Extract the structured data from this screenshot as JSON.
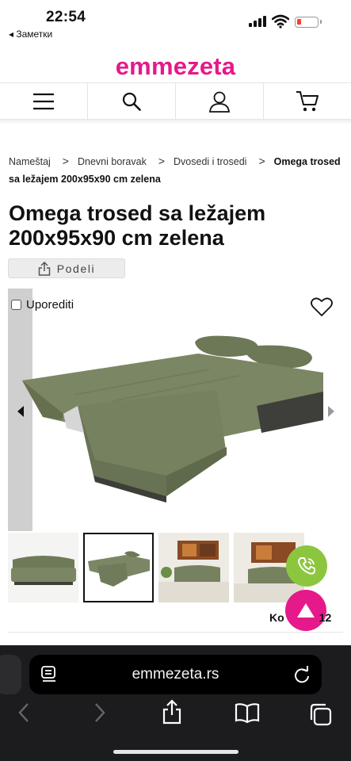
{
  "status_bar": {
    "time": "22:54",
    "back_label": "◂ Заметки"
  },
  "site": {
    "logo": "emmezeta",
    "brand_color": "#e5198a"
  },
  "header_icons": [
    "menu-icon",
    "search-icon",
    "user-icon",
    "cart-icon"
  ],
  "breadcrumb": {
    "items": [
      "Nameštaj",
      "Dnevni boravak",
      "Dvosedi i trosedi"
    ],
    "current": "Omega trosed sa ležajem 200x95x90 cm zelena",
    "separator": ">"
  },
  "product": {
    "title": "Omega trosed sa ležajem 200x95x90 cm zelena",
    "share_label": "Podeli",
    "compare_label": "Uporediti",
    "code_label": "Ko",
    "code_suffix": "12"
  },
  "safari": {
    "url": "emmezeta.rs"
  },
  "colors": {
    "sofa_green": "#76815f",
    "call_button": "#8cc63f",
    "scroll_top_button": "#e5198a"
  }
}
